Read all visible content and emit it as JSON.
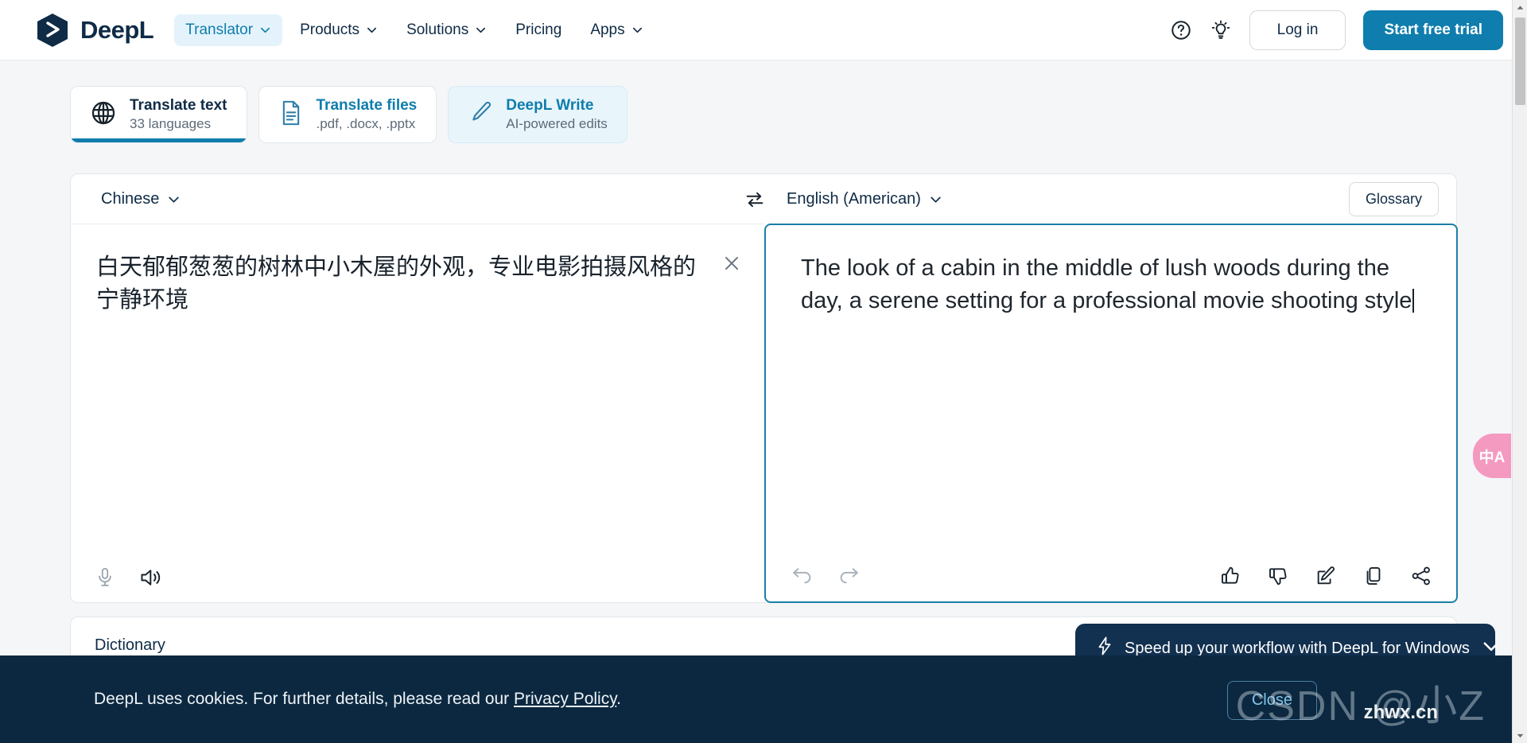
{
  "header": {
    "brand": "DeepL",
    "logo_icon": "deepl-logo-icon",
    "nav": [
      {
        "label": "Translator",
        "icon": "chevron-down-icon",
        "active": true
      },
      {
        "label": "Products",
        "icon": "chevron-down-icon",
        "active": false
      },
      {
        "label": "Solutions",
        "icon": "chevron-down-icon",
        "active": false
      },
      {
        "label": "Pricing",
        "icon": "",
        "active": false
      },
      {
        "label": "Apps",
        "icon": "chevron-down-icon",
        "active": false
      }
    ],
    "help_icon": "question-circle-icon",
    "idea_icon": "lightbulb-icon",
    "login_label": "Log in",
    "trial_label": "Start free trial"
  },
  "tabs": [
    {
      "title": "Translate text",
      "subtitle": "33 languages",
      "icon": "globe-icon",
      "state": "active"
    },
    {
      "title": "Translate files",
      "subtitle": ".pdf, .docx, .pptx",
      "icon": "document-icon",
      "state": "default"
    },
    {
      "title": "DeepL Write",
      "subtitle": "AI-powered edits",
      "icon": "pencil-icon",
      "state": "highlighted"
    }
  ],
  "translator": {
    "source_language": "Chinese",
    "target_language": "English (American)",
    "swap_icon": "swap-arrows-icon",
    "glossary_label": "Glossary",
    "source_text": "白天郁郁葱葱的树林中小木屋的外观，专业电影拍摄风格的宁静环境",
    "target_text": "The look of a cabin in the middle of lush woods during the day, a serene setting for a professional movie shooting style",
    "clear_icon": "close-x-icon",
    "source_tools": [
      {
        "name": "microphone-icon",
        "state": "disabled"
      },
      {
        "name": "speaker-icon",
        "state": "enabled"
      }
    ],
    "target_tools_left": [
      {
        "name": "undo-icon",
        "state": "disabled"
      },
      {
        "name": "redo-icon",
        "state": "disabled"
      }
    ],
    "target_tools_right": [
      {
        "name": "thumbs-up-icon",
        "state": "enabled"
      },
      {
        "name": "thumbs-down-icon",
        "state": "enabled"
      },
      {
        "name": "edit-icon",
        "state": "enabled"
      },
      {
        "name": "copy-icon",
        "state": "enabled"
      },
      {
        "name": "share-icon",
        "state": "enabled"
      }
    ]
  },
  "dictionary": {
    "label": "Dictionary"
  },
  "promo": {
    "text": "Speed up your workflow with DeepL for Windows",
    "lightning_icon": "lightning-bolt-icon",
    "collapse_icon": "chevron-down-icon"
  },
  "cookie_banner": {
    "text_before": "DeepL uses cookies. For further details, please read our ",
    "link_label": "Privacy Policy",
    "text_after": ".",
    "close_label": "Close"
  },
  "side_widget": {
    "label": "中A",
    "icon": "translate-widget-icon"
  },
  "watermark": {
    "main": "CSDN @小Z",
    "sub": "zhwx.cn"
  },
  "scrollbar": {
    "up_icon": "scroll-up-arrow-icon",
    "down_icon": "scroll-down-arrow-icon"
  },
  "colors": {
    "brand_dark": "#0f2b46",
    "accent_blue": "#0f7dad",
    "tab_highlight": "#e8f5fb",
    "banner_dark": "#0b2840",
    "widget_pink": "#f49ac1"
  }
}
